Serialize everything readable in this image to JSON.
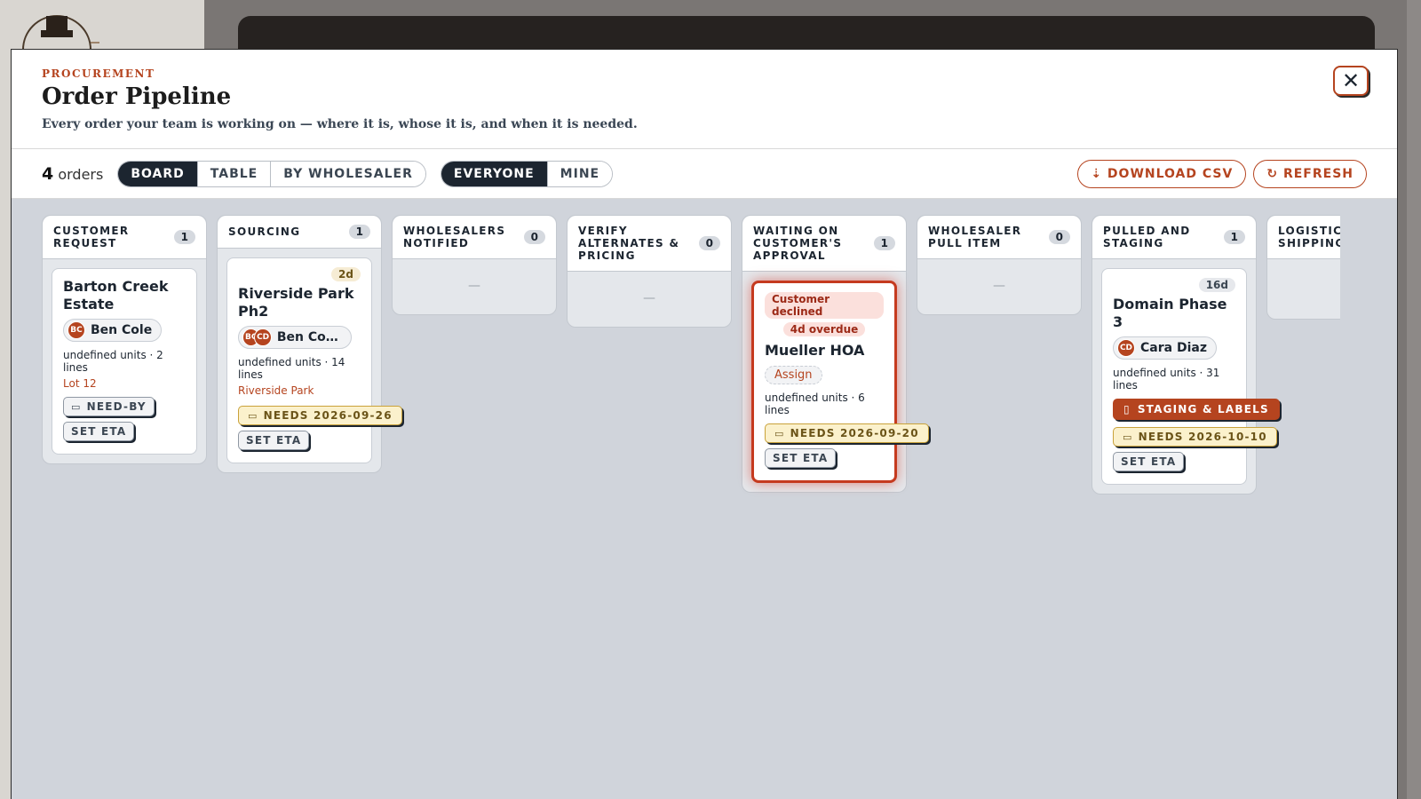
{
  "modal": {
    "eyebrow": "PROCUREMENT",
    "title": "Order Pipeline",
    "subtitle": "Every order your team is working on — where it is, whose it is, and when it is needed.",
    "close_label": "✕"
  },
  "toolbar": {
    "count": "4",
    "count_label": "orders",
    "views": [
      "BOARD",
      "TABLE",
      "BY WHOLESALER"
    ],
    "active_view": "BOARD",
    "scopes": [
      "EVERYONE",
      "MINE"
    ],
    "active_scope": "EVERYONE",
    "download_label": "⇣ DOWNLOAD CSV",
    "refresh_label": "↻ REFRESH"
  },
  "columns": [
    {
      "name": "CUSTOMER REQUEST",
      "count": "1"
    },
    {
      "name": "SOURCING",
      "count": "1"
    },
    {
      "name": "WHOLESALERS NOTIFIED",
      "count": "0",
      "empty": "—"
    },
    {
      "name": "VERIFY ALTERNATES & PRICING",
      "count": "0",
      "empty": "—"
    },
    {
      "name": "WAITING ON CUSTOMER'S APPROVAL",
      "count": "1"
    },
    {
      "name": "WHOLESALER PULL ITEM",
      "count": "0",
      "empty": "—"
    },
    {
      "name": "PULLED AND STAGING",
      "count": "1"
    },
    {
      "name": "LOGISTICS SHIPPING",
      "count": ""
    }
  ],
  "cards": {
    "barton": {
      "title": "Barton Creek Estate",
      "avatars": [
        "BC"
      ],
      "owner": "Ben Cole",
      "meta": "undefined units · 2 lines",
      "location": "Lot 12",
      "need_by": "NEED-BY",
      "set_eta": "SET ETA"
    },
    "riverside": {
      "age": "2d",
      "title": "Riverside Park Ph2",
      "avatars": [
        "BC",
        "CD"
      ],
      "owner": "Ben Col...",
      "meta": "undefined units · 14 lines",
      "location": "Riverside Park",
      "needs": "NEEDS 2026-09-26",
      "set_eta": "SET ETA"
    },
    "mueller": {
      "declined": "Customer declined",
      "overdue": "4d overdue",
      "title": "Mueller HOA",
      "assign": "Assign",
      "meta": "undefined units · 6 lines",
      "needs": "NEEDS 2026-09-20",
      "set_eta": "SET ETA"
    },
    "domain": {
      "age": "16d",
      "title": "Domain Phase 3",
      "avatars": [
        "CD"
      ],
      "owner": "Cara Diaz",
      "meta": "undefined units · 31 lines",
      "staging": "STAGING & LABELS",
      "needs": "NEEDS 2026-10-10",
      "set_eta": "SET ETA"
    }
  },
  "colors": {
    "accent": "#b5441f",
    "dark": "#1c2530",
    "alert": "#c53a1f",
    "needs_bg": "#fbf1cc"
  },
  "icons": {
    "calendar": "calendar-icon",
    "clipboard": "clipboard-icon",
    "close": "close-icon",
    "download": "download-icon",
    "refresh": "refresh-icon"
  }
}
